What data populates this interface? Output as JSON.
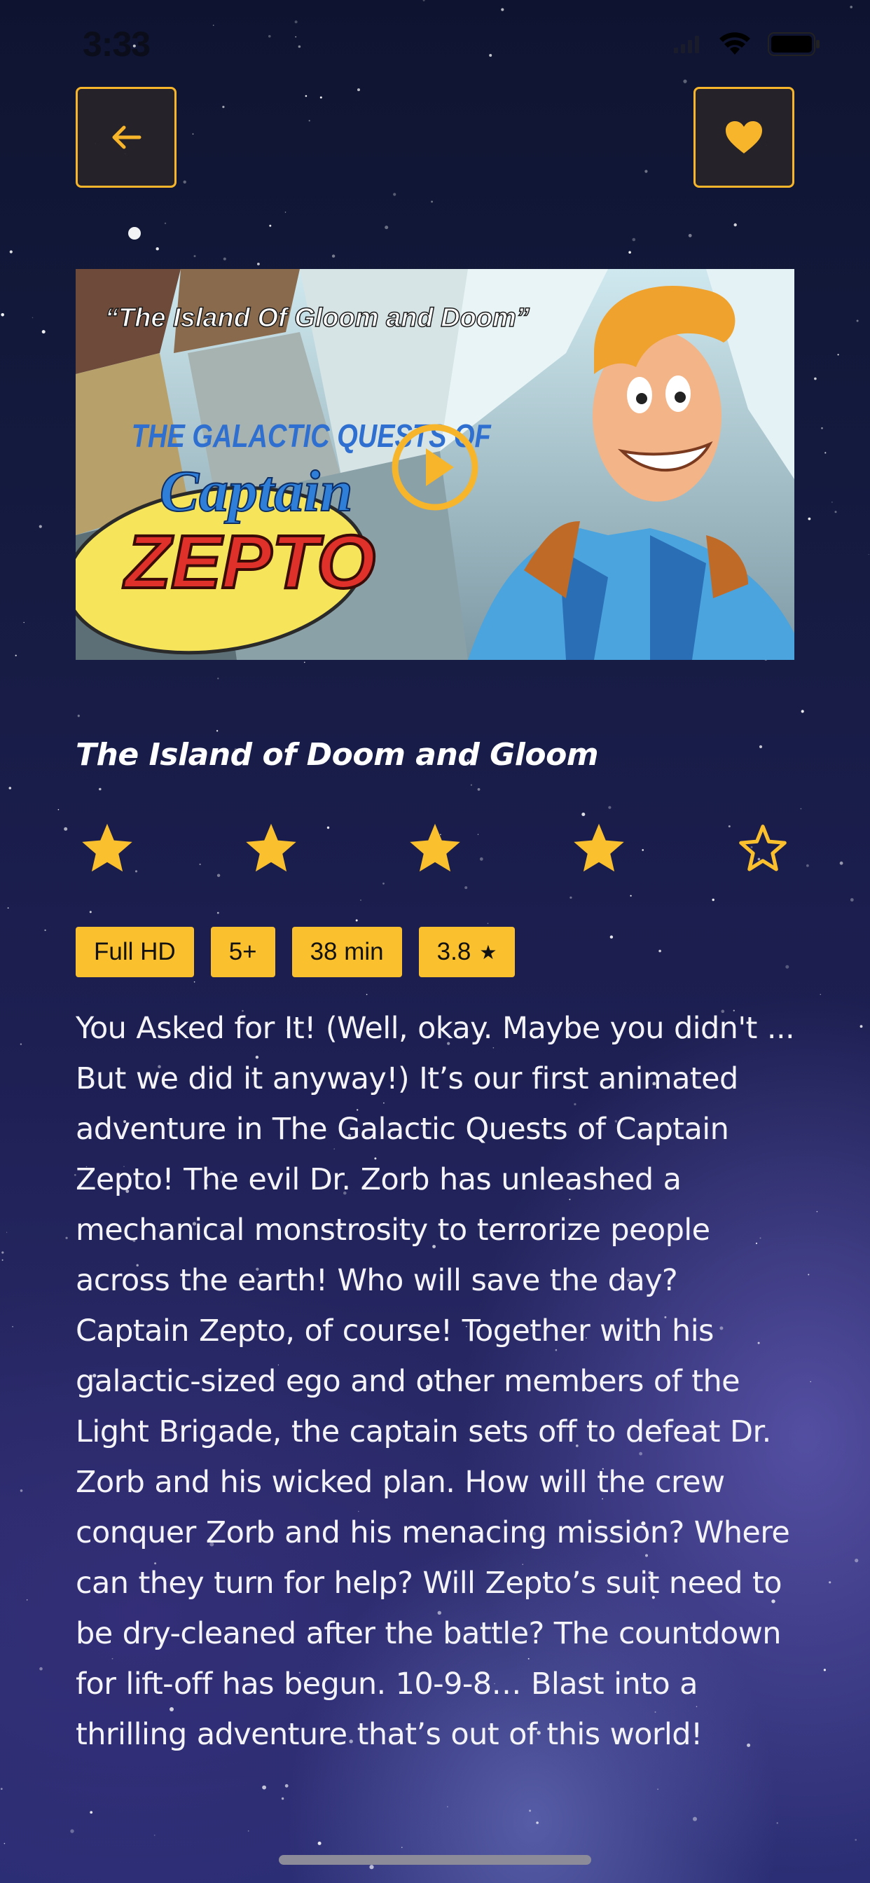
{
  "status_bar": {
    "time": "3:33"
  },
  "icons": {
    "back": "arrow-left-icon",
    "favorite": "heart-icon",
    "play": "play-icon",
    "rating_filled": "star-filled-icon",
    "rating_empty": "star-outline-icon"
  },
  "colors": {
    "accent": "#fbc02d",
    "button_border": "#f6b52a",
    "button_bg": "#2a2428"
  },
  "video": {
    "thumbnail_title": "“The Island Of Gloom and Doom”",
    "series_line1": "THE GALACTIC QUESTS OF",
    "series_line2": "Captain",
    "series_line3": "ZEPTO"
  },
  "episode": {
    "title": "The Island of Doom and Gloom",
    "rating": 4,
    "rating_max": 5
  },
  "tags": [
    {
      "label": "Full HD"
    },
    {
      "label": "5+"
    },
    {
      "label": "38 min"
    },
    {
      "label": "3.8",
      "icon": "★"
    }
  ],
  "description": "You Asked for It! (Well, okay. Maybe you didn't ... But we did it anyway!) It’s our first animated adventure in The Galactic Quests of Captain Zepto! The evil Dr. Zorb has unleashed a mechanical monstrosity to terrorize people across the earth! Who will save the day? Captain Zepto, of course! Together with his galactic-sized ego and other members of the Light Brigade, the captain sets off to defeat Dr. Zorb and his wicked plan.  How will the crew conquer Zorb and his menacing mission? Where can they turn for help? Will Zepto’s suit need to be dry-cleaned after the battle? The countdown for lift-off has begun. 10-9-8… Blast into a thrilling adventure that’s out of this world!"
}
